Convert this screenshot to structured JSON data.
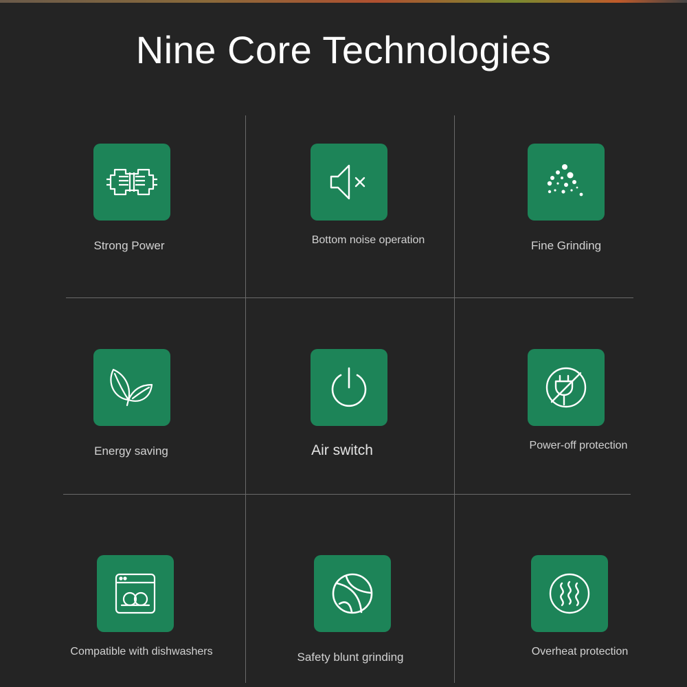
{
  "title": "Nine Core Technologies",
  "colors": {
    "background": "#242424",
    "tile": "#1d8458",
    "divider": "#6a6a6a",
    "title": "#ffffff",
    "label": "#d2d2d2"
  },
  "features": [
    {
      "label": "Strong Power",
      "icon": "motor-icon"
    },
    {
      "label": "Bottom noise operation",
      "icon": "speaker-mute-icon"
    },
    {
      "label": "Fine Grinding",
      "icon": "particles-icon"
    },
    {
      "label": "Energy saving",
      "icon": "leaves-icon"
    },
    {
      "label": "Air switch",
      "icon": "power-icon"
    },
    {
      "label": "Power-off protection",
      "icon": "no-plug-icon"
    },
    {
      "label": "Compatible with dishwashers",
      "icon": "dishwasher-icon"
    },
    {
      "label": "Safety blunt grinding",
      "icon": "ball-icon"
    },
    {
      "label": "Overheat protection",
      "icon": "heat-waves-icon"
    }
  ]
}
